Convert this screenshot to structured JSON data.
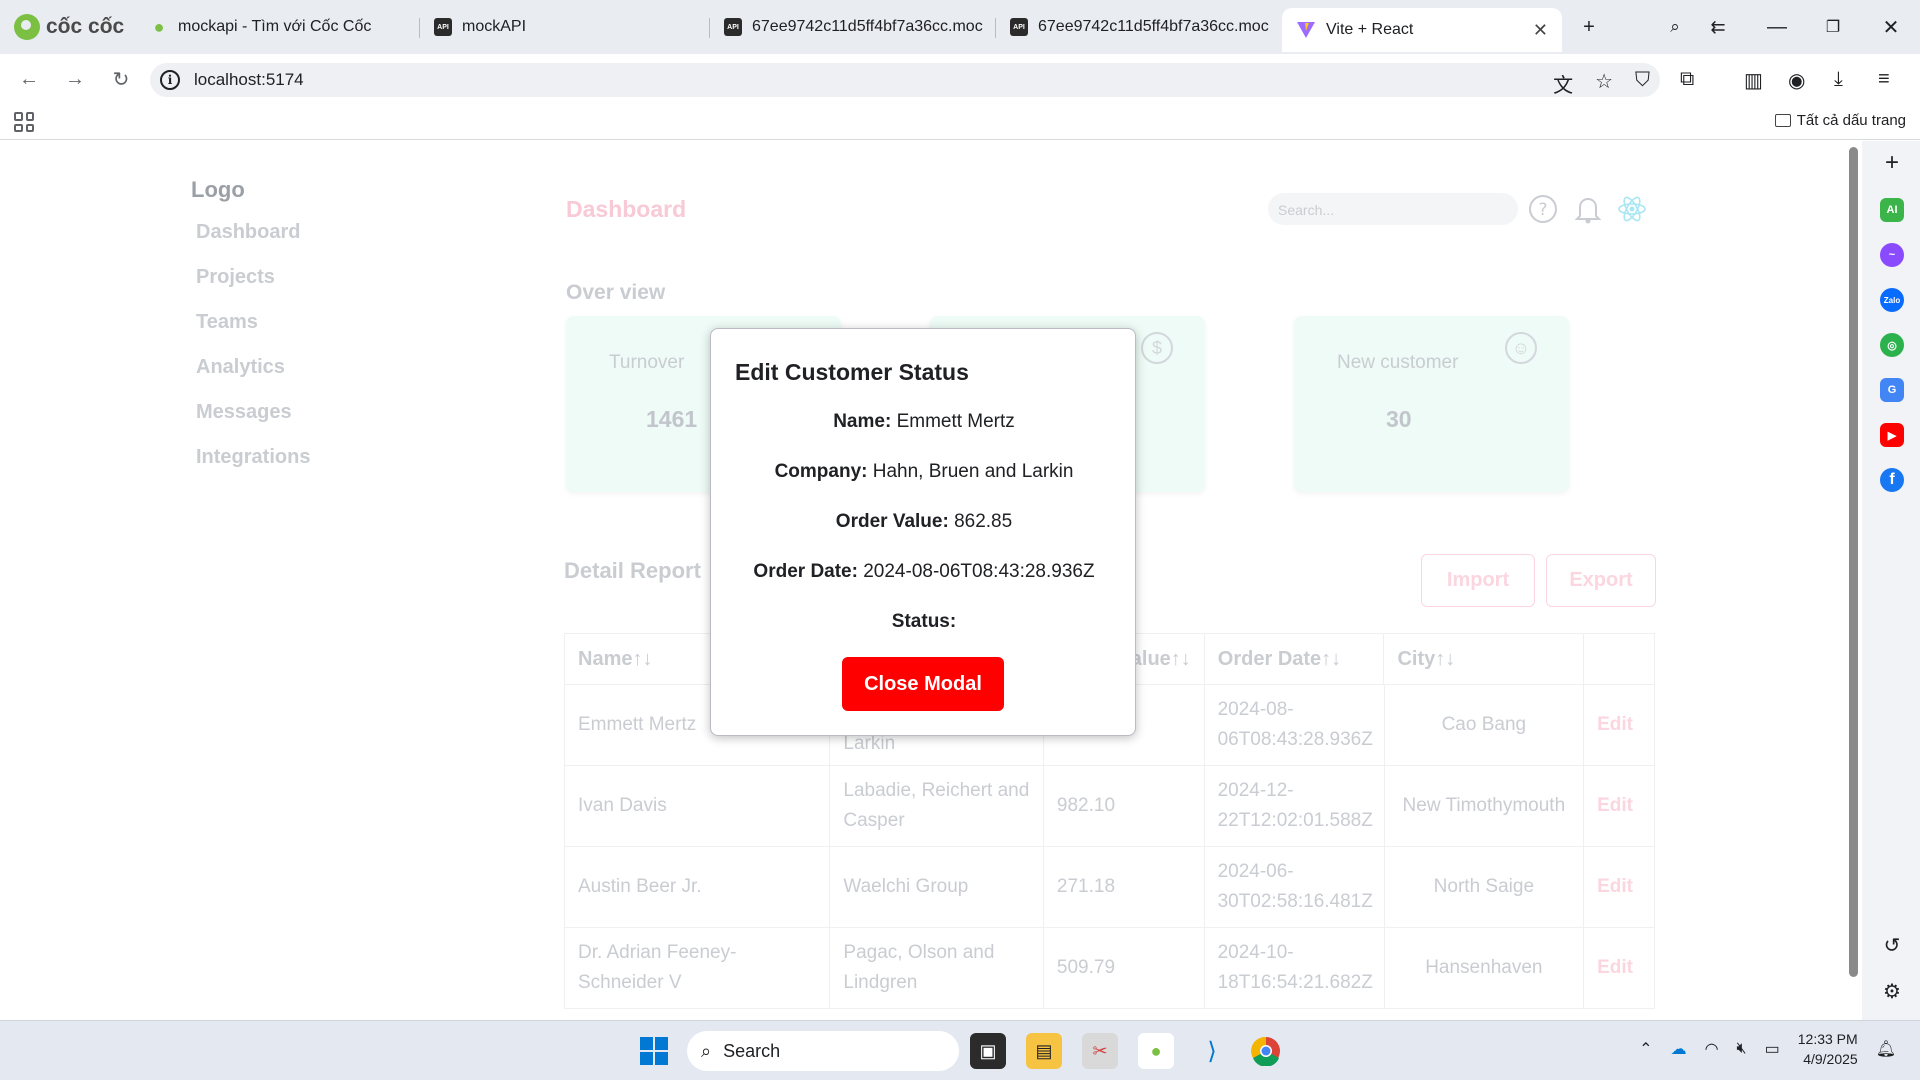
{
  "browser": {
    "brand": "cốc cốc",
    "tabs": [
      {
        "title": "mockapi - Tìm với Cốc Cốc"
      },
      {
        "title": "mockAPI"
      },
      {
        "title": "67ee9742c11d5ff4bf7a36cc.moc"
      },
      {
        "title": "67ee9742c11d5ff4bf7a36cc.moc"
      },
      {
        "title": "Vite + React"
      }
    ],
    "url": "localhost:5174",
    "bookmarks_all": "Tất cả dấu trang"
  },
  "app": {
    "logo": "Logo",
    "nav": [
      "Dashboard",
      "Projects",
      "Teams",
      "Analytics",
      "Messages",
      "Integrations"
    ],
    "page_title": "Dashboard",
    "search_placeholder": "Search...",
    "overview_title": "Over view",
    "cards": [
      {
        "label": "Turnover",
        "value": "1461"
      },
      {
        "label": "",
        "value": ""
      },
      {
        "label": "New customer",
        "value": "30"
      }
    ],
    "detail_title": "Detail Report",
    "import_label": "Import",
    "export_label": "Export",
    "table": {
      "headers": [
        "Name↑↓",
        "",
        "",
        "Order Date↑↓",
        "City↑↓"
      ],
      "value_header_tail": "alue↑↓",
      "rows": [
        {
          "name": "Emmett Mertz",
          "company": "Larkin",
          "value": "",
          "date": "2024-08-06T08:43:28.936Z",
          "city": "Cao Bang",
          "edit": "Edit"
        },
        {
          "name": "Ivan Davis",
          "company": "Labadie, Reichert and Casper",
          "value": "982.10",
          "date": "2024-12-22T12:02:01.588Z",
          "city": "New Timothymouth",
          "edit": "Edit"
        },
        {
          "name": "Austin Beer Jr.",
          "company": "Waelchi Group",
          "value": "271.18",
          "date": "2024-06-30T02:58:16.481Z",
          "city": "North Saige",
          "edit": "Edit"
        },
        {
          "name": "Dr. Adrian Feeney-Schneider V",
          "company": "Pagac, Olson and Lindgren",
          "value": "509.79",
          "date": "2024-10-18T16:54:21.682Z",
          "city": "Hansenhaven",
          "edit": "Edit"
        }
      ]
    }
  },
  "modal": {
    "title": "Edit Customer Status",
    "name_label": "Name:",
    "name_value": "Emmett Mertz",
    "company_label": "Company:",
    "company_value": "Hahn, Bruen and Larkin",
    "order_value_label": "Order Value:",
    "order_value_value": "862.85",
    "order_date_label": "Order Date:",
    "order_date_value": "2024-08-06T08:43:28.936Z",
    "status_label": "Status:",
    "close_label": "Close Modal"
  },
  "taskbar": {
    "search_label": "Search",
    "time": "12:33 PM",
    "date": "4/9/2025"
  },
  "colors": {
    "accent_red": "#ff0000",
    "card_bg": "#eefbf6",
    "muted_pink": "#fbd6e0"
  }
}
